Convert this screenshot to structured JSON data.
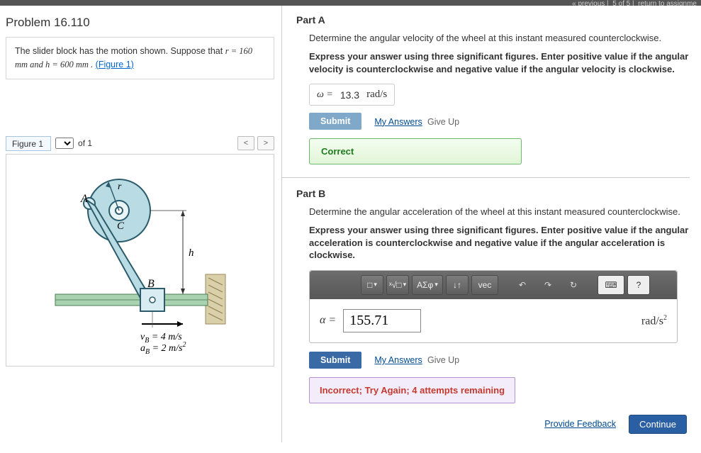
{
  "topbar": {
    "prev": "« previous",
    "progress": "5 of 5",
    "return": "return to assignme"
  },
  "left": {
    "title": "Problem 16.110",
    "desc1": "The slider block has the motion shown. Suppose that ",
    "descItalic": "r = 160  mm and h = 600  mm .",
    "figLink": "(Figure 1)",
    "figLabel": "Figure 1",
    "ofLabel": "of 1",
    "prev": "<",
    "next": ">",
    "figText": {
      "A": "A",
      "C": "C",
      "r": "r",
      "h": "h",
      "B": "B",
      "v": "v",
      "a": "a",
      "vVal": " = 4 m/s",
      "aVal": " = 2 m/s",
      "sub": "B",
      "sq": "2"
    }
  },
  "partA": {
    "title": "Part A",
    "prompt": "Determine the angular velocity of the wheel at this instant measured counterclockwise.",
    "boldPrompt": "Express your answer using three significant figures. Enter positive value if the angular velocity is counterclockwise and negative value if the angular velocity is clockwise.",
    "varLabel": "ω =",
    "value": "13.3",
    "unit": "rad/s",
    "submit": "Submit",
    "myAnswers": "My Answers",
    "giveUp": "Give Up",
    "correct": "Correct"
  },
  "partB": {
    "title": "Part B",
    "prompt": "Determine the angular acceleration of the wheel at this instant measured counterclockwise.",
    "boldPrompt": "Express your answer using three significant figures. Enter positive value if the angular acceleration is counterclockwise and negative value if the angular acceleration is clockwise.",
    "toolbar": {
      "templ": "□",
      "root": "ˣ√□",
      "greek": "ΑΣφ",
      "updown": "↓↑",
      "vec": "vec",
      "undo": "↶",
      "redo": "↷",
      "reset": "↻",
      "kb": "⌨",
      "help": "?"
    },
    "alphaLabel": "α =",
    "value": "155.71",
    "unit": "rad/s",
    "unitSup": "2",
    "submit": "Submit",
    "myAnswers": "My Answers",
    "giveUp": "Give Up",
    "incorrect": "Incorrect; Try Again; 4 attempts remaining"
  },
  "footer": {
    "feedback": "Provide Feedback",
    "continue": "Continue"
  }
}
